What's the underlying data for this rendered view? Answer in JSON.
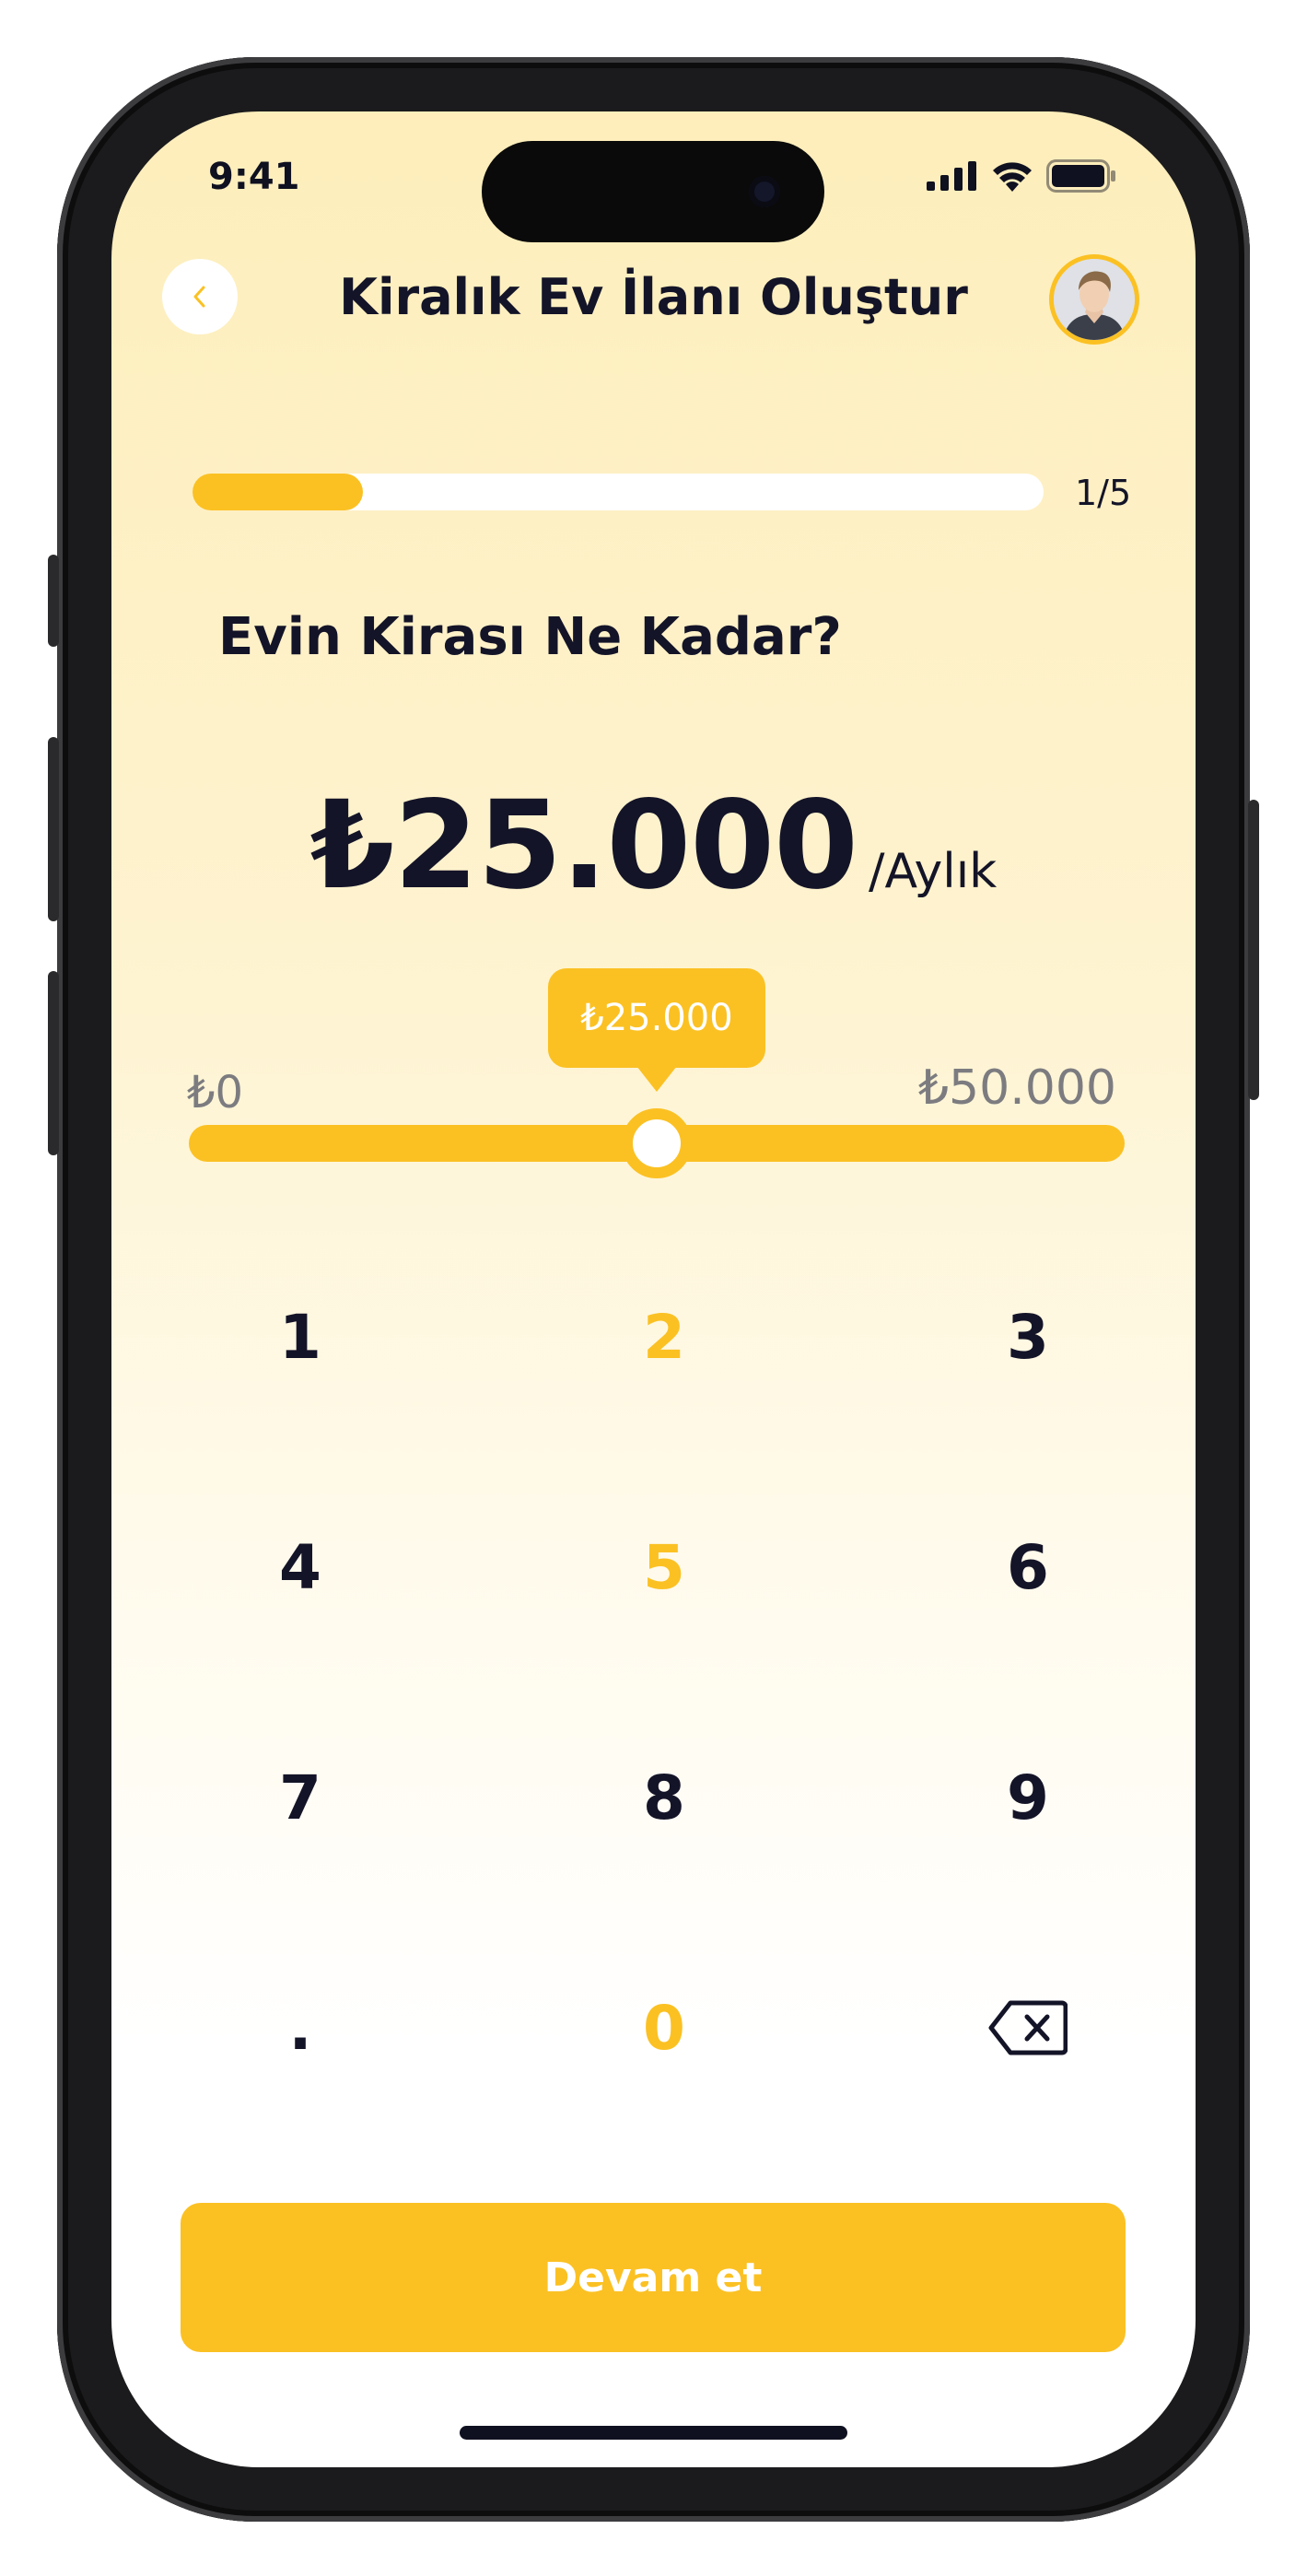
{
  "status_bar": {
    "time": "9:41"
  },
  "header": {
    "back_icon": "chevron-left-icon",
    "title": "Kiralık Ev İlanı Oluştur",
    "avatar_icon": "user-avatar"
  },
  "progress": {
    "label": "1/5",
    "fraction": 0.2
  },
  "question": "Evin Kirası Ne Kadar?",
  "price": {
    "value": "₺25.000",
    "unit": "/Aylık"
  },
  "slider": {
    "min_label": "₺0",
    "max_label": "₺50.000",
    "tooltip": "₺25.000",
    "min": 0,
    "max": 50000,
    "value": 25000
  },
  "keypad": {
    "keys": [
      {
        "label": "1",
        "highlight": false
      },
      {
        "label": "2",
        "highlight": true
      },
      {
        "label": "3",
        "highlight": false
      },
      {
        "label": "4",
        "highlight": false
      },
      {
        "label": "5",
        "highlight": true
      },
      {
        "label": "6",
        "highlight": false
      },
      {
        "label": "7",
        "highlight": false
      },
      {
        "label": "8",
        "highlight": false
      },
      {
        "label": "9",
        "highlight": false
      },
      {
        "label": ".",
        "highlight": false
      },
      {
        "label": "0",
        "highlight": true
      },
      {
        "label": "",
        "highlight": false,
        "icon": "backspace-icon"
      }
    ]
  },
  "cta": {
    "label": "Devam et"
  },
  "colors": {
    "accent": "#fbc123",
    "text": "#141428",
    "muted": "#7c7c80",
    "background_top": "#fdeebb",
    "background_bottom": "#ffffff"
  }
}
